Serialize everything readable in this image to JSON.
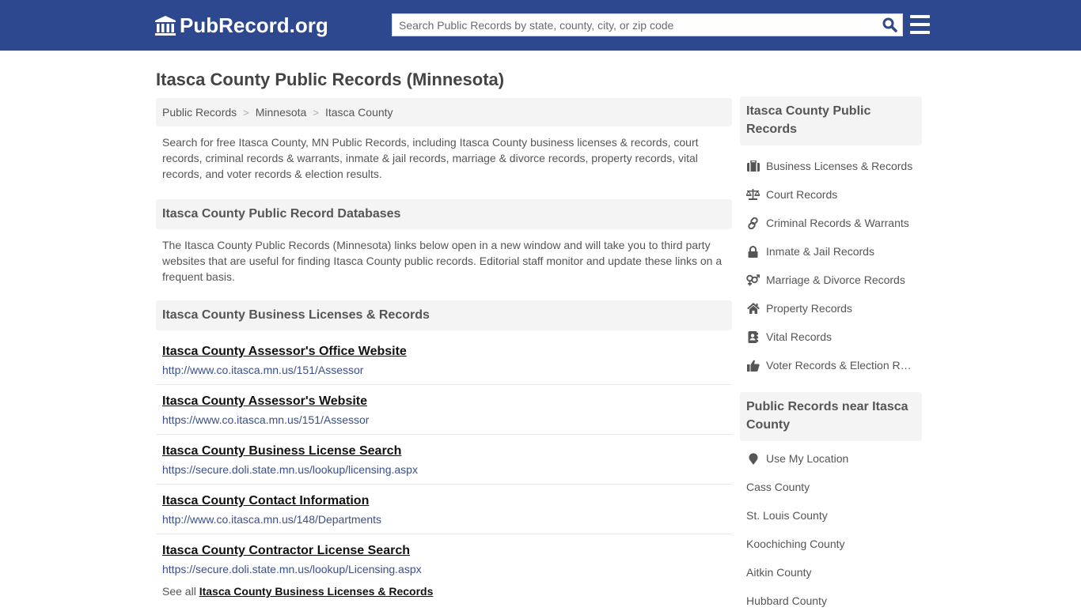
{
  "header": {
    "logo_text": "PubRecord.org",
    "search_placeholder": "Search Public Records by state, county, city, or zip code",
    "search_value": ""
  },
  "page_title": "Itasca County Public Records (Minnesota)",
  "breadcrumb": [
    {
      "label": "Public Records"
    },
    {
      "label": "Minnesota"
    },
    {
      "label": "Itasca County"
    }
  ],
  "breadcrumb_separator": ">",
  "intro": "Search for free Itasca County, MN Public Records, including Itasca County business licenses & records, court records, criminal records & warrants, inmate & jail records, marriage & divorce records, property records, vital records, and voter records & election results.",
  "databases": {
    "heading": "Itasca County Public Record Databases",
    "text": "The Itasca County Public Records (Minnesota) links below open in a new window and will take you to third party websites that are useful for finding Itasca County public records. Editorial staff monitor and update these links on a frequent basis."
  },
  "business_section": {
    "heading": "Itasca County Business Licenses & Records",
    "links": [
      {
        "title": "Itasca County Assessor's Office Website",
        "url": "http://www.co.itasca.mn.us/151/Assessor"
      },
      {
        "title": "Itasca County Assessor's Website",
        "url": "https://www.co.itasca.mn.us/151/Assessor"
      },
      {
        "title": "Itasca County Business License Search",
        "url": "https://secure.doli.state.mn.us/lookup/licensing.aspx"
      },
      {
        "title": "Itasca County Contact Information",
        "url": "http://www.co.itasca.mn.us/148/Departments"
      },
      {
        "title": "Itasca County Contractor License Search",
        "url": "https://secure.doli.state.mn.us/lookup/Licensing.aspx"
      }
    ],
    "see_all_prefix": "See all",
    "see_all_link": "Itasca County Business Licenses & Records"
  },
  "sidebar": {
    "records_heading": "Itasca County Public Records",
    "records_items": [
      {
        "label": "Business Licenses & Records",
        "icon": "briefcase-icon"
      },
      {
        "label": "Court Records",
        "icon": "scales-icon"
      },
      {
        "label": "Criminal Records & Warrants",
        "icon": "link-icon"
      },
      {
        "label": "Inmate & Jail Records",
        "icon": "lock-icon"
      },
      {
        "label": "Marriage & Divorce Records",
        "icon": "gender-icon"
      },
      {
        "label": "Property Records",
        "icon": "home-icon"
      },
      {
        "label": "Vital Records",
        "icon": "contact-book-icon"
      },
      {
        "label": "Voter Records & Election Results",
        "icon": "thumbs-up-icon"
      }
    ],
    "near_heading": "Public Records near Itasca County",
    "use_location": "Use My Location",
    "near_items": [
      {
        "label": "Cass County"
      },
      {
        "label": "St. Louis County"
      },
      {
        "label": "Koochiching County"
      },
      {
        "label": "Aitkin County"
      },
      {
        "label": "Hubbard County"
      }
    ]
  },
  "colors": {
    "header_bg": "#2e4890",
    "search_icon": "#2e4890",
    "panel_bg": "#f4f4f4",
    "url_text": "#3a4f8a"
  }
}
